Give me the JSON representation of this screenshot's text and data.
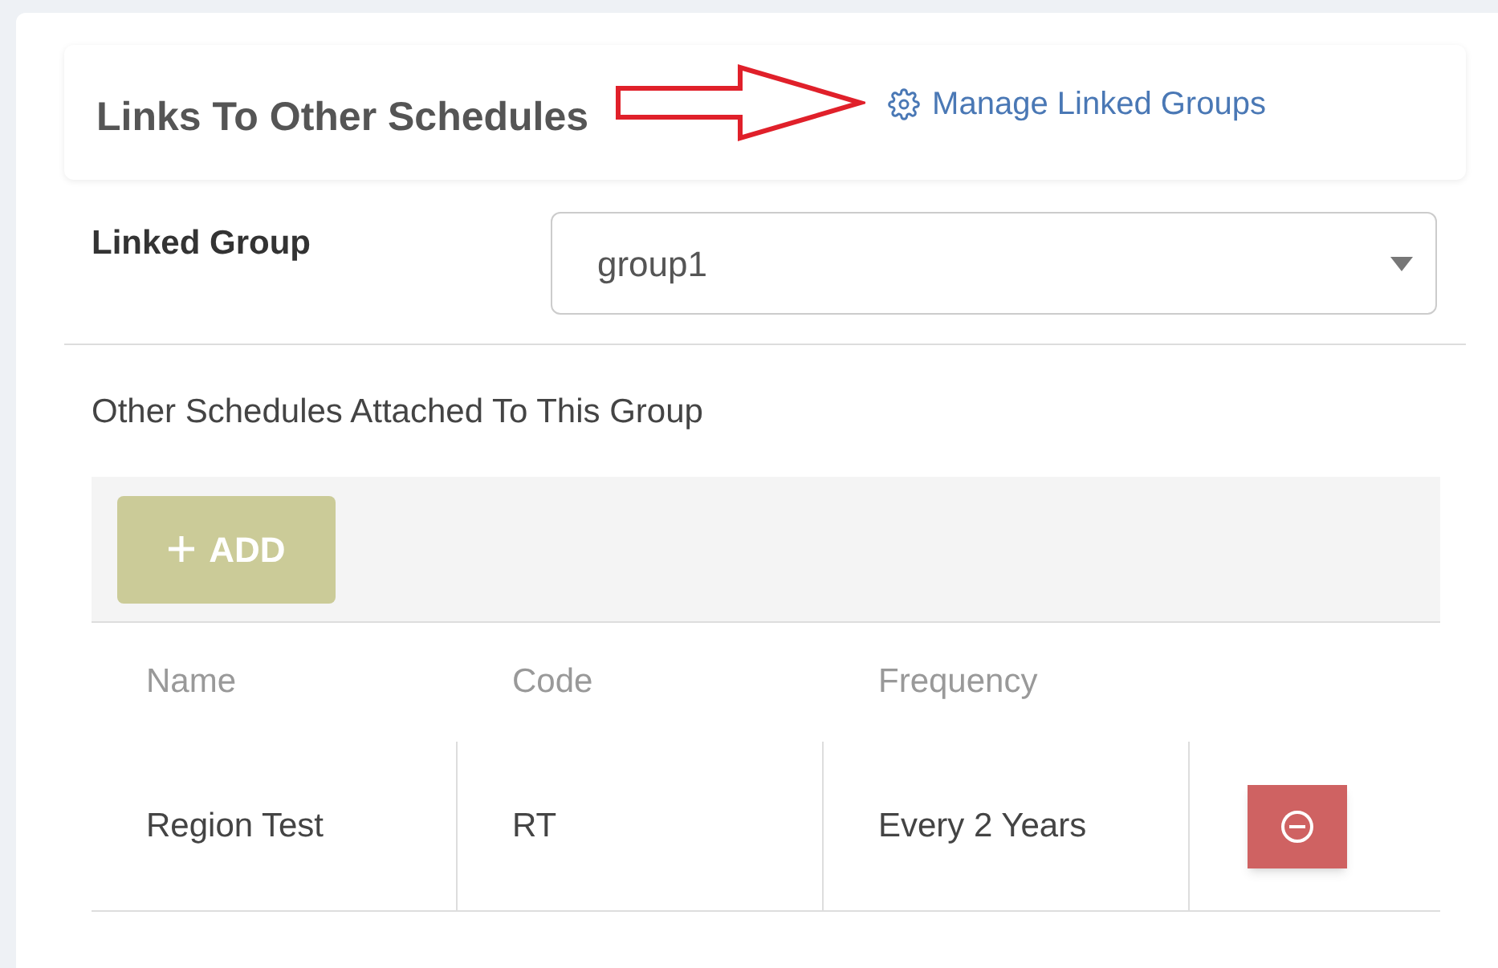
{
  "header": {
    "title": "Links To Other Schedules",
    "link": "Manage Linked Groups"
  },
  "linked_group": {
    "label": "Linked Group",
    "value": "group1"
  },
  "subtitle": "Other Schedules Attached To This Group",
  "add_button": {
    "label": "ADD",
    "disabled": true
  },
  "table": {
    "columns": [
      "Name",
      "Code",
      "Frequency"
    ],
    "rows": [
      {
        "cells": [
          "Region Test",
          "RT",
          "Every 2 Years"
        ]
      }
    ]
  }
}
